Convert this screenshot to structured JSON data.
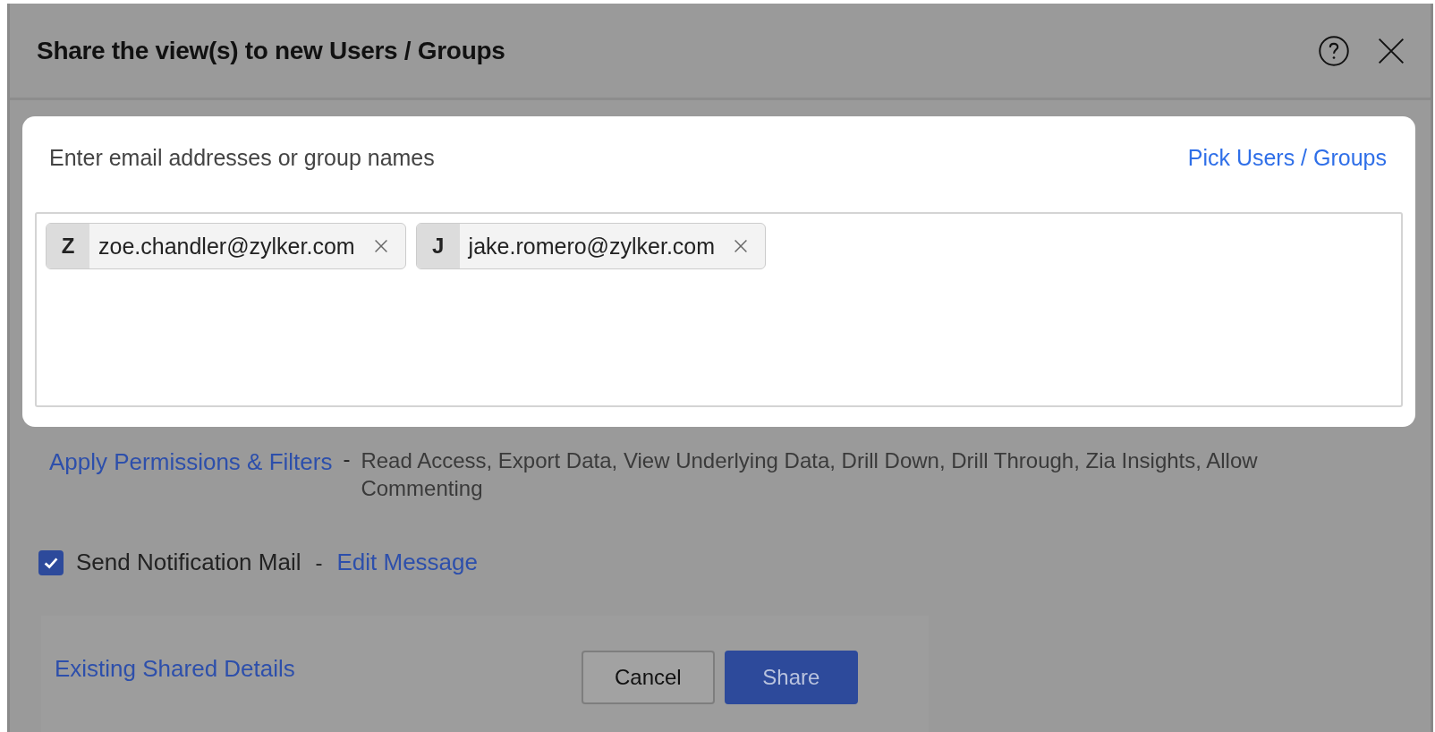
{
  "dialog": {
    "title": "Share the view(s) to new Users / Groups"
  },
  "recipients": {
    "prompt": "Enter email addresses or group names",
    "pick_link": "Pick Users / Groups",
    "chips": [
      {
        "initial": "Z",
        "email": "zoe.chandler@zylker.com"
      },
      {
        "initial": "J",
        "email": "jake.romero@zylker.com"
      }
    ]
  },
  "permissions": {
    "link": "Apply Permissions & Filters",
    "separator": "-",
    "summary": "Read Access, Export Data, View Underlying Data, Drill Down, Drill Through, Zia Insights, Allow Commenting"
  },
  "notification": {
    "checked": true,
    "label": "Send Notification Mail",
    "separator": "-",
    "edit_link": "Edit Message"
  },
  "footer": {
    "existing_link": "Existing Shared Details",
    "buttons": [
      {
        "kind": "secondary",
        "label": "Cancel"
      },
      {
        "kind": "primary",
        "label": "Share"
      }
    ]
  }
}
